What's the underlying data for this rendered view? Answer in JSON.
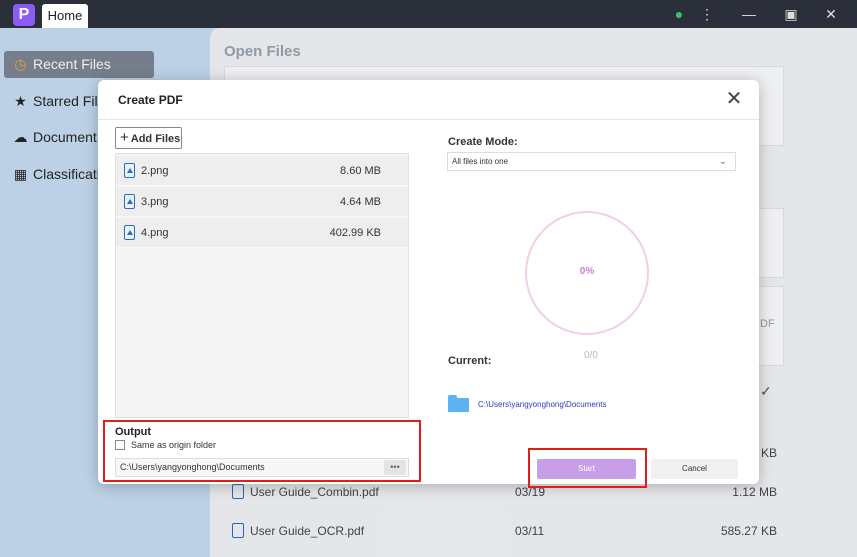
{
  "titlebar": {
    "app_logo": "P",
    "tab_home": "Home",
    "user_icon": "user-icon",
    "more_icon": "more-icon",
    "minimize": "minimize-icon",
    "maximize": "maximize-icon",
    "close": "close-icon"
  },
  "sidebar": {
    "items": [
      {
        "label": "Recent Files",
        "icon": "clock-icon",
        "active": true
      },
      {
        "label": "Starred Files",
        "icon": "star-icon",
        "active": false
      },
      {
        "label": "Document Cloud",
        "icon": "cloud-icon",
        "active": false
      },
      {
        "label": "Classification",
        "icon": "grid-icon",
        "active": false
      }
    ]
  },
  "main": {
    "open_files_title": "Open Files",
    "ghost_text_1": "DF",
    "recent_files": [
      {
        "name": "",
        "date": "",
        "size": "KB"
      },
      {
        "name": "User Guide_Combin.pdf",
        "date": "03/19",
        "size": "1.12 MB"
      },
      {
        "name": "User Guide_OCR.pdf",
        "date": "03/11",
        "size": "585.27 KB"
      }
    ]
  },
  "dialog": {
    "title": "Create PDF",
    "add_files": "Add Files",
    "files": [
      {
        "name": "2.png",
        "size": "8.60 MB"
      },
      {
        "name": "3.png",
        "size": "4.64 MB"
      },
      {
        "name": "4.png",
        "size": "402.99 KB"
      }
    ],
    "output_label": "Output",
    "same_as_origin": "Same as origin folder",
    "output_path": "C:\\Users\\yangyonghong\\Documents",
    "browse": "•••",
    "create_mode_label": "Create Mode:",
    "create_mode_value": "All files into one",
    "progress": "0%",
    "count": "0/0",
    "current_label": "Current:",
    "current_path": "C:\\Users\\yangyonghong\\Documents",
    "start": "Start",
    "cancel": "Cancel"
  },
  "colors": {
    "accent": "#c99ee8",
    "highlight_box": "#e01e1e",
    "link": "#2a3dc7",
    "sidebar_active": "#7c8591"
  }
}
